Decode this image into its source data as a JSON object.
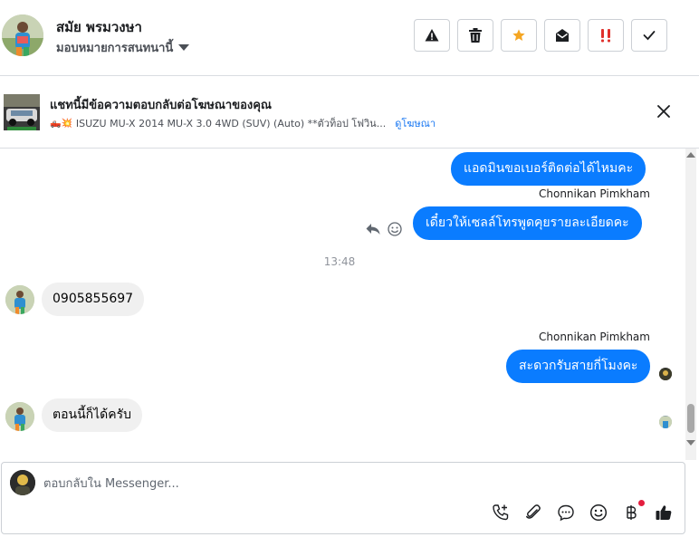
{
  "header": {
    "contact_name": "สมัย พรมวงษา",
    "assign_label": "มอบหมายการสนทนานี้",
    "toolbar": [
      {
        "name": "report-spam",
        "icon": "warning-icon"
      },
      {
        "name": "delete",
        "icon": "trash-icon"
      },
      {
        "name": "star",
        "icon": "star-icon",
        "color": "#f5a623"
      },
      {
        "name": "mark-unread",
        "icon": "envelope-open-icon"
      },
      {
        "name": "mark-important",
        "icon": "double-exclamation-icon",
        "color": "#e0302b"
      },
      {
        "name": "mark-done",
        "icon": "check-icon"
      }
    ]
  },
  "ad": {
    "title": "แชทนี้มีข้อความตอบกลับต่อโฆษณาของคุณ",
    "emoji": "🛻💥",
    "description": "ISUZU MU-X 2014 MU-X 3.0 4WD (SUV) (Auto) **ตัวท็อป โฟวิน...",
    "link_label": "ดูโฆษณา"
  },
  "messages": {
    "out_1": "แอดมินขอเบอร์ติดต่อได้ไหมคะ",
    "sender_1": "Chonnikan Pimkham",
    "out_2": "เดี๋ยวให้เซลล์โทรพูดคุยรายละเอียดคะ",
    "timestamp": "13:48",
    "in_1": "0905855697",
    "sender_2": "Chonnikan Pimkham",
    "out_3": "สะดวกรับสายกี่โมงคะ",
    "in_2": "ตอนนี้ก็ได้ครับ"
  },
  "composer": {
    "placeholder": "ตอบกลับใน Messenger...",
    "value": "",
    "actions": [
      "call-add-icon",
      "paperclip-icon",
      "saved-reply-icon",
      "emoji-icon",
      "baht-icon",
      "thumbs-up-icon"
    ]
  },
  "colors": {
    "outgoing_bubble": "#0a7cff",
    "incoming_bubble": "#f0f0f0",
    "link": "#1877f2"
  }
}
